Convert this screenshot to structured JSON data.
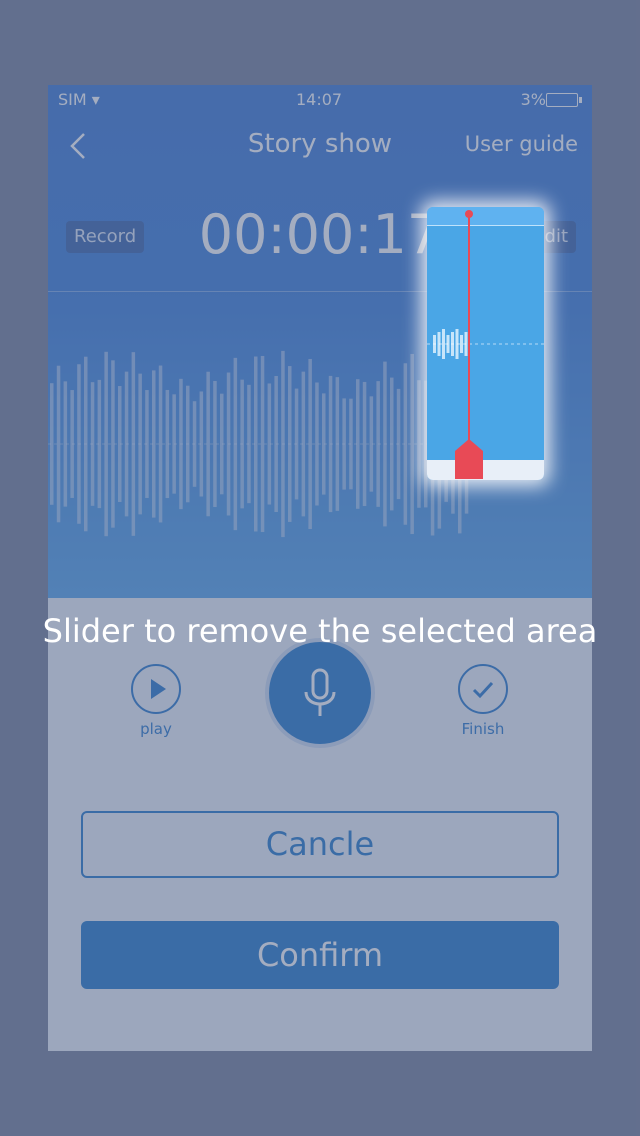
{
  "status_bar": {
    "carrier": "SIM ▾",
    "time": "14:07",
    "battery": "3%"
  },
  "nav": {
    "title": "Story show",
    "user_guide": "User guide"
  },
  "recorder": {
    "record_label": "Record",
    "timer": "00:00:17",
    "edit_label": "Edit"
  },
  "hint": "Slider to remove the selected area",
  "controls": {
    "play_label": "play",
    "finish_label": "Finish"
  },
  "buttons": {
    "cancel": "Cancle",
    "confirm": "Confirm"
  },
  "icons": [
    "back-chevron-icon",
    "double-chevron-left-icon",
    "hand-tap-icon",
    "play-icon",
    "microphone-icon",
    "check-icon"
  ],
  "colors": {
    "primary": "#1670c6",
    "playhead": "#e84a56"
  }
}
